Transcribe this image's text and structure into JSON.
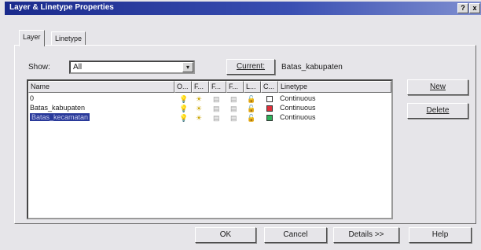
{
  "window": {
    "title": "Layer & Linetype Properties",
    "help_glyph": "?",
    "close_glyph": "x"
  },
  "tabs": [
    {
      "label": "Layer"
    },
    {
      "label": "Linetype"
    }
  ],
  "show": {
    "label": "Show:",
    "value": "All",
    "arrow": "▾"
  },
  "current": {
    "button_label": "Current:",
    "value": "Batas_kabupaten"
  },
  "columns": {
    "name": "Name",
    "on": "O...",
    "freeze": "F...",
    "freeze_vp": "F...",
    "freeze_new": "F...",
    "lock": "L...",
    "color": "C...",
    "linetype": "Linetype"
  },
  "icons": {
    "on": "💡",
    "freeze": "☀",
    "freeze_vp": "▤",
    "freeze_new": "▤",
    "lock": "🔓"
  },
  "layers": [
    {
      "name": "0",
      "color": "#ffffff",
      "linetype": "Continuous"
    },
    {
      "name": "Batas_kabupaten",
      "color": "#e0303a",
      "linetype": "Continuous"
    },
    {
      "name": "Batas_kecamatan",
      "color": "#2fb25a",
      "linetype": "Continuous"
    }
  ],
  "side_buttons": {
    "new": "New",
    "delete": "Delete"
  },
  "footer": {
    "ok": "OK",
    "cancel": "Cancel",
    "details": "Details >>",
    "help": "Help"
  }
}
